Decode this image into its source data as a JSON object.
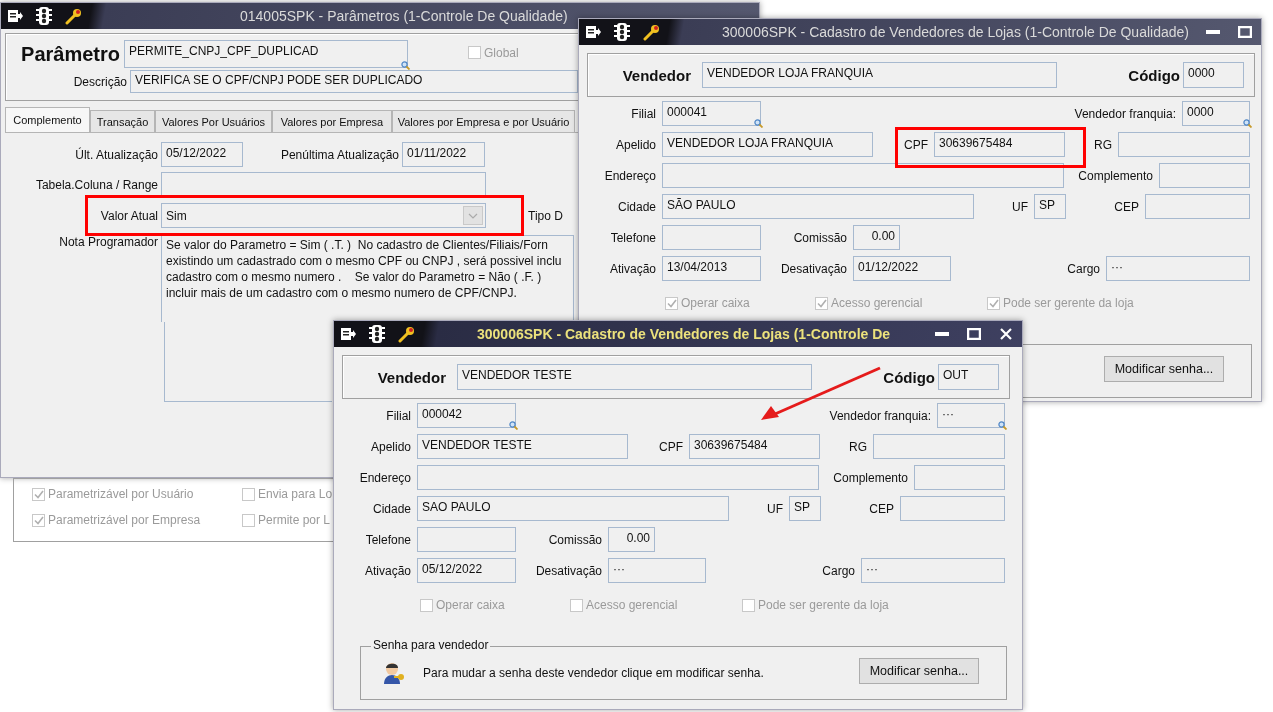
{
  "parametros_window": {
    "title": "014005SPK - Parâmetros (1-Controle De Qualidade)",
    "parametro": {
      "label": "Parâmetro",
      "value": "PERMITE_CNPJ_CPF_DUPLICAD"
    },
    "global": {
      "label": "Global",
      "checked": false,
      "disabled": true
    },
    "descricao": {
      "label": "Descrição",
      "value": "VERIFICA SE O CPF/CNPJ PODE SER DUPLICADO"
    },
    "tabs": [
      {
        "label": "Complemento",
        "selected": true
      },
      {
        "label": "Transação",
        "selected": false
      },
      {
        "label": "Valores Por Usuários",
        "selected": false
      },
      {
        "label": "Valores por Empresa",
        "selected": false
      },
      {
        "label": "Valores por Empresa e por Usuário",
        "selected": false
      }
    ],
    "ult_atualizacao": {
      "label": "Últ. Atualização",
      "value": "05/12/2022"
    },
    "penultima_atualizacao": {
      "label": "Penúltima Atualização",
      "value": "01/11/2022"
    },
    "tabela_coluna": {
      "label": "Tabela.Coluna / Range"
    },
    "valor_atual": {
      "label": "Valor Atual",
      "value": "Sim"
    },
    "tipo_label": "Tipo D",
    "nota_programador": {
      "label": "Nota Programador",
      "lines": [
        "Se valor do Parametro = Sim ( .T. )  No cadastro de Clientes/Filiais/Forn",
        "existindo um cadastrado com o mesmo CPF ou CNPJ , será possivel inclu",
        "cadastro com o mesmo numero .    Se valor do Parametro = Não ( .F. )",
        "incluir mais de um cadastro com o mesmo numero de CPF/CNPJ."
      ]
    },
    "checkboxes": [
      {
        "label": "Parametrizável por Usuário",
        "checked": true,
        "disabled": true
      },
      {
        "label": "Envia para Lo",
        "checked": false,
        "disabled": true
      },
      {
        "label": "Parametrizável por Empresa",
        "checked": true,
        "disabled": true
      },
      {
        "label": "Permite por L",
        "checked": false,
        "disabled": true
      }
    ]
  },
  "vendedor_window_back": {
    "title": "300006SPK - Cadastro de Vendedores de Lojas (1-Controle De Qualidade)",
    "active": false,
    "header": {
      "label": "Vendedor",
      "value": "VENDEDOR LOJA FRANQUIA",
      "code_label": "Código",
      "code": "0000"
    },
    "rows": [
      [
        {
          "label": "Filial",
          "value": "000041",
          "lookup": true
        },
        {
          "label": "Vendedor franquia:",
          "value": "0000",
          "lookup": true
        }
      ],
      [
        {
          "label": "Apelido",
          "value": "VENDEDOR LOJA FRANQUIA"
        },
        {
          "label": "CPF",
          "value": "30639675484"
        },
        {
          "label": "RG"
        }
      ],
      [
        {
          "label": "Endereço"
        },
        {
          "label": "Complemento"
        }
      ],
      [
        {
          "label": "Cidade",
          "value": "SÃO PAULO"
        },
        {
          "label": "UF",
          "value": "SP"
        },
        {
          "label": "CEP"
        }
      ],
      [
        {
          "label": "Telefone"
        },
        {
          "label": "Comissão",
          "value": "0.00"
        }
      ],
      [
        {
          "label": "Ativação",
          "value": "13/04/2013"
        },
        {
          "label": "Desativação",
          "value": "01/12/2022"
        },
        {
          "label": "Cargo",
          "value": "···"
        }
      ]
    ],
    "checkboxes": [
      {
        "label": "Operar caixa",
        "checked": true,
        "disabled": true
      },
      {
        "label": "Acesso gerencial",
        "checked": true,
        "disabled": true
      },
      {
        "label": "Pode ser gerente da loja",
        "checked": true,
        "disabled": true
      }
    ],
    "password_group": {
      "button": "Modificar senha..."
    }
  },
  "vendedor_window_front": {
    "title": "300006SPK - Cadastro de Vendedores de Lojas (1-Controle De",
    "active": true,
    "header": {
      "label": "Vendedor",
      "value": "VENDEDOR TESTE",
      "code_label": "Código",
      "code": "OUT"
    },
    "rows": [
      [
        {
          "label": "Filial",
          "value": "000042",
          "lookup": true
        },
        {
          "label": "Vendedor franquia:",
          "value": "···",
          "lookup": true
        }
      ],
      [
        {
          "label": "Apelido",
          "value": "VENDEDOR TESTE"
        },
        {
          "label": "CPF",
          "value": "30639675484"
        },
        {
          "label": "RG"
        }
      ],
      [
        {
          "label": "Endereço"
        },
        {
          "label": "Complemento"
        }
      ],
      [
        {
          "label": "Cidade",
          "value": "SAO PAULO"
        },
        {
          "label": "UF",
          "value": "SP"
        },
        {
          "label": "CEP"
        }
      ],
      [
        {
          "label": "Telefone"
        },
        {
          "label": "Comissão",
          "value": "0.00"
        }
      ],
      [
        {
          "label": "Ativação",
          "value": "05/12/2022"
        },
        {
          "label": "Desativação",
          "value": "···"
        },
        {
          "label": "Cargo",
          "value": "···"
        }
      ]
    ],
    "checkboxes": [
      {
        "label": "Operar caixa",
        "checked": false,
        "disabled": true
      },
      {
        "label": "Acesso gerencial",
        "checked": false,
        "disabled": true
      },
      {
        "label": "Pode ser gerente da loja",
        "checked": false,
        "disabled": true
      }
    ],
    "password_group": {
      "title": "Senha para vendedor",
      "text": "Para mudar a senha deste vendedor clique em modificar senha.",
      "button": "Modificar senha..."
    }
  }
}
